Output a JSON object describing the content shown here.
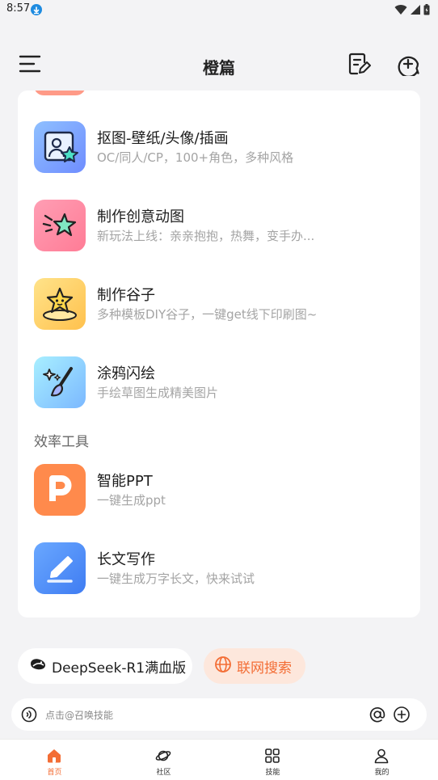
{
  "status_bar": {
    "time": "8:57"
  },
  "header": {
    "title": "橙篇"
  },
  "items": [
    {
      "name": "抠图-壁纸/头像/插画",
      "desc": "OC/同人/CP，100+角色，多种风格"
    },
    {
      "name": "制作创意动图",
      "desc": "新玩法上线：亲亲抱抱，热舞，变手办..."
    },
    {
      "name": "制作谷子",
      "desc": "多种模板DIY谷子，一键get线下印刷图~"
    },
    {
      "name": "涂鸦闪绘",
      "desc": "手绘草图生成精美图片"
    }
  ],
  "section_title": "效率工具",
  "tools": [
    {
      "name": "智能PPT",
      "desc": "一键生成ppt"
    },
    {
      "name": "长文写作",
      "desc": "一键生成万字长文，快来试试"
    }
  ],
  "chips": {
    "deepseek": "DeepSeek-R1满血版",
    "search": "联网搜索"
  },
  "input": {
    "placeholder": "点击@召唤技能"
  },
  "tabs": [
    {
      "label": "首页",
      "active": true
    },
    {
      "label": "社区",
      "active": false
    },
    {
      "label": "技能",
      "active": false
    },
    {
      "label": "我的",
      "active": false
    }
  ],
  "colors": {
    "accent": "#f36d35",
    "background": "#f3f3f5",
    "chip_search_bg": "#fde7dc"
  }
}
